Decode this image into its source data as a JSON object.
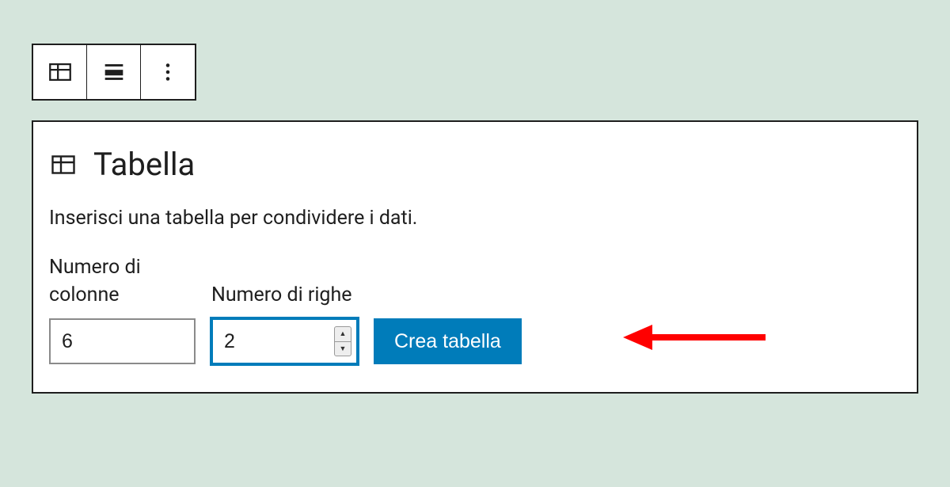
{
  "block": {
    "title": "Tabella",
    "description": "Inserisci una tabella per condividere i dati.",
    "columns_label": "Numero di colonne",
    "rows_label": "Numero di righe",
    "columns_value": "6",
    "rows_value": "2",
    "create_button": "Crea tabella"
  },
  "colors": {
    "primary": "#007cba",
    "arrow": "#ff0000"
  }
}
